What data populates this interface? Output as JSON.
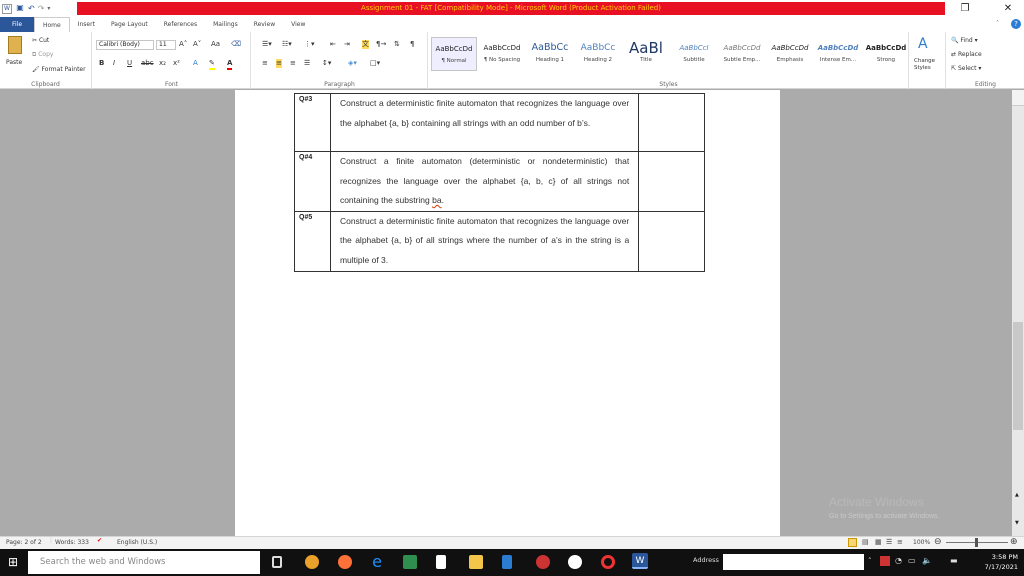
{
  "window": {
    "title": "Assignment 01 - FAT [Compatibility Mode] - Microsoft Word (Product Activation Failed)",
    "minimize": "–",
    "restore": "▢",
    "close": "✕"
  },
  "qat": {
    "word_icon": "W",
    "save": "💾",
    "undo": "↶",
    "redo": "↷"
  },
  "tabs": [
    "File",
    "Home",
    "Insert",
    "Page Layout",
    "References",
    "Mailings",
    "Review",
    "View"
  ],
  "ribbon": {
    "clipboard": {
      "label": "Clipboard",
      "paste": "Paste",
      "cut": "Cut",
      "copy": "Copy",
      "format_painter": "Format Painter"
    },
    "font": {
      "label": "Font",
      "font_name": "Calibri (Body)",
      "font_size": "11",
      "bold": "B",
      "italic": "I",
      "underline": "U",
      "grow": "A˄",
      "shrink": "A˅",
      "change_case": "Aa"
    },
    "paragraph": {
      "label": "Paragraph"
    },
    "styles": {
      "label": "Styles",
      "items": [
        {
          "preview": "AaBbCcDd",
          "name": "¶ Normal"
        },
        {
          "preview": "AaBbCcDd",
          "name": "¶ No Spacing"
        },
        {
          "preview": "AaBbCc",
          "name": "Heading 1"
        },
        {
          "preview": "AaBbCc",
          "name": "Heading 2"
        },
        {
          "preview": "AaBl",
          "name": "Title"
        },
        {
          "preview": "AaBbCcI",
          "name": "Subtitle"
        },
        {
          "preview": "AaBbCcDd",
          "name": "Subtle Emp..."
        },
        {
          "preview": "AaBbCcDd",
          "name": "Emphasis"
        },
        {
          "preview": "AaBbCcDd",
          "name": "Intense Em..."
        },
        {
          "preview": "AaBbCcDd",
          "name": "Strong"
        }
      ],
      "change_styles": "Change Styles"
    },
    "editing": {
      "label": "Editing",
      "find": "Find",
      "replace": "Replace",
      "select": "Select"
    }
  },
  "document": {
    "rows": [
      {
        "q": "Q#3",
        "text": "Construct a deterministic finite automaton that recognizes the language over the alphabet {a, b} containing all strings with an odd number of b’s."
      },
      {
        "q": "Q#4",
        "text_before": "Construct a finite automaton (deterministic or nondeterministic) that recognizes the language over the alphabet {a, b, c} of all strings not containing the substring ",
        "text_underlined": "ba",
        "text_after": "."
      },
      {
        "q": "Q#5",
        "text": "Construct a deterministic finite automaton that recognizes the language over the alphabet {a, b} of all strings where the number of a’s in the string is a multiple of 3."
      }
    ]
  },
  "watermark": {
    "line1": "Activate Windows",
    "line2": "Go to Settings to activate Windows."
  },
  "status": {
    "page": "Page: 2 of 2",
    "words": "Words: 333",
    "language": "English (U.S.)",
    "zoom": "100%"
  },
  "taskbar": {
    "search_placeholder": "Search the web and Windows",
    "address_label": "Address",
    "time": "3:58 PM",
    "date": "7/17/2021"
  }
}
